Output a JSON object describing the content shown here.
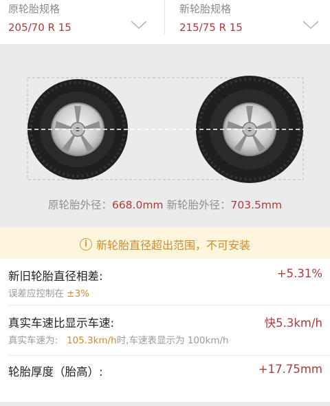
{
  "old_tire": {
    "label": "原轮胎规格",
    "value": "205/70 R 15",
    "icon": "chevron-down-icon"
  },
  "new_tire": {
    "label": "新轮胎规格",
    "value": "215/75 R 15",
    "icon": "chevron-down-icon"
  },
  "diameters": {
    "old_label": "原轮胎外径：",
    "old_value": "668.0mm",
    "new_label": "新轮胎外径：",
    "new_value": "703.5mm"
  },
  "warning": {
    "icon": "info-icon",
    "text": "新轮胎直径超出范围，不可安装"
  },
  "details": {
    "diameter_diff": {
      "title": "新旧轮胎直径相差:",
      "value": "+5.31%",
      "sub_prefix": "误差应控制在 ",
      "sub_highlight": "±3%"
    },
    "speed": {
      "title": "真实车速比显示车速:",
      "value": "快5.3km/h",
      "sub_prefix": "真实车速为:   ",
      "sub_highlight": "105.3km/h",
      "sub_suffix": "时,车速表显示为 100km/h"
    },
    "thickness": {
      "title": "轮胎厚度（胎高）:",
      "value": "+17.75mm"
    }
  },
  "colors": {
    "accent": "#b03a3a",
    "warning": "#cf8a2f",
    "warning_bg": "#fdf6dd"
  }
}
